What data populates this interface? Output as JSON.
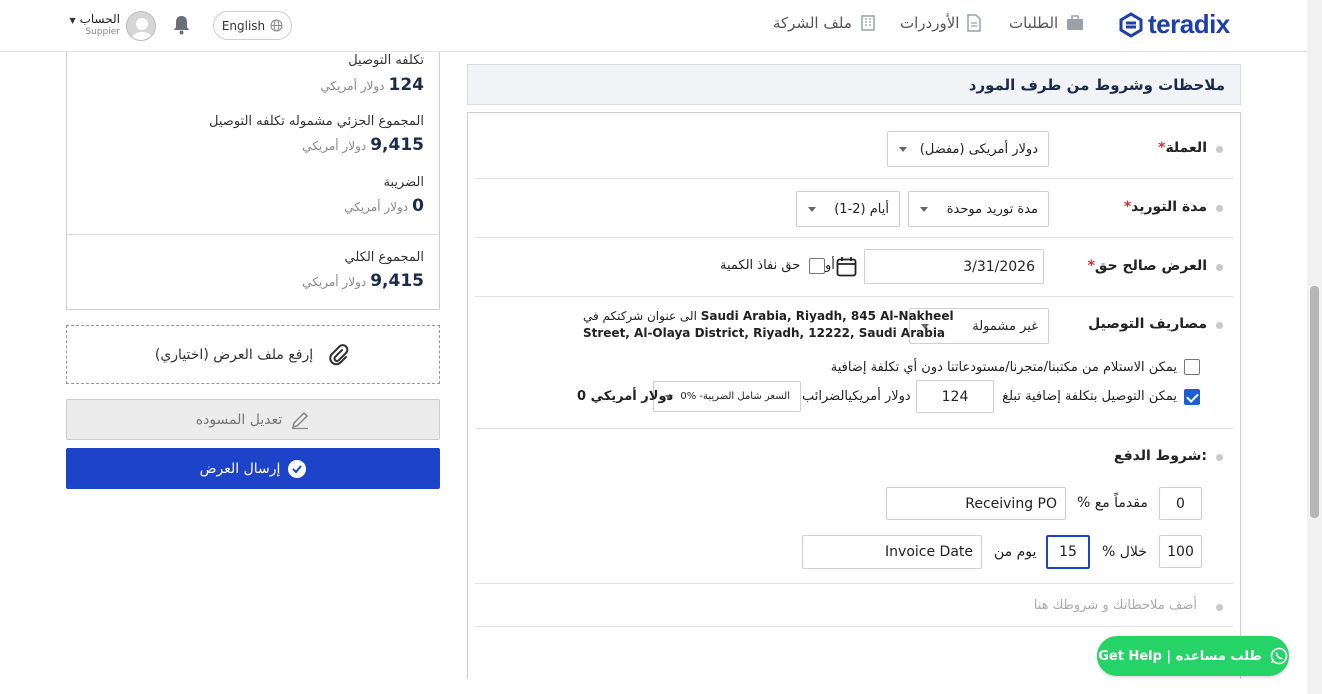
{
  "header": {
    "logo": "teradix",
    "nav": {
      "requests": "الطلبات",
      "orders": "الأوردرات",
      "company": "ملف الشركة"
    },
    "lang": "English",
    "account": {
      "name": "الحساب",
      "role": "Suppier"
    }
  },
  "summary": {
    "delivery_cost_label": "تكلفه التوصيل",
    "delivery_cost_value": "124",
    "subtotal_label": "المجموع الجزئي مشموله تكلفه التوصيل",
    "subtotal_value": "9,415",
    "tax_label": "الضريبة",
    "tax_value": "0",
    "total_label": "المجموع الكلي",
    "total_value": "9,415",
    "currency": "دولار أمريكي"
  },
  "actions": {
    "upload_label": "إرفع ملف العرض (اختياري)",
    "draft_label": "تعديل المسوده",
    "send_label": "إرسال العرض"
  },
  "section": {
    "title": "ملاحظات وشروط من طرف المورد",
    "currency_label": "العملة",
    "currency_value": "دولار أمريكى (مفضل)",
    "supply_label": "مدة التوريد",
    "supply_type": "مدة توريد موحدة",
    "supply_days": "(1-2) أيام",
    "validity_label": "العرض صالح حق",
    "validity_date": "3/31/2026",
    "validity_or": "أو",
    "validity_qty": "حق نفاذ الكمية",
    "delivery_label": "مصاريف التوصيل",
    "delivery_option": "غير مشمولة",
    "delivery_address_prefix": "الى عنوان شركتكم في",
    "delivery_address_line1": "Saudi Arabia, Riyadh, 845 Al-Nakheel",
    "delivery_address_line2": "Street, Al-Olaya District, Riyadh, 12222, Saudi Arabia",
    "pickup_text": "يمكن الاستلام من مكتبنا/متجرنا/مستودعاتنا دون أي تكلفة إضافية",
    "extra_cost_text": "يمكن التوصيل بتكلفة إضافية تبلغ",
    "extra_cost_value": "124",
    "extra_cost_currency_taxes": "دولار أمريكيالضرائب",
    "tax_select": "0% -السعر شامل الضريبة",
    "tax_amount": "0 دولار أمريكي",
    "payment_label": "شروط الدفع:",
    "pay1_percent": "0",
    "pay1_text": "% مقدماً مع",
    "pay1_ref": "Receiving PO",
    "pay2_percent": "100",
    "pay2_text": "% خلال",
    "pay2_days": "15",
    "pay2_from": "يوم من",
    "pay2_ref": "Invoice Date",
    "notes_placeholder": "أضف ملاحظاتك و شروطك هنا"
  },
  "help": {
    "label": "Get Help | طلب مساعده"
  },
  "colors": {
    "brand": "#1d43c8",
    "whatsapp": "#25d366",
    "required": "#d32f2f"
  }
}
